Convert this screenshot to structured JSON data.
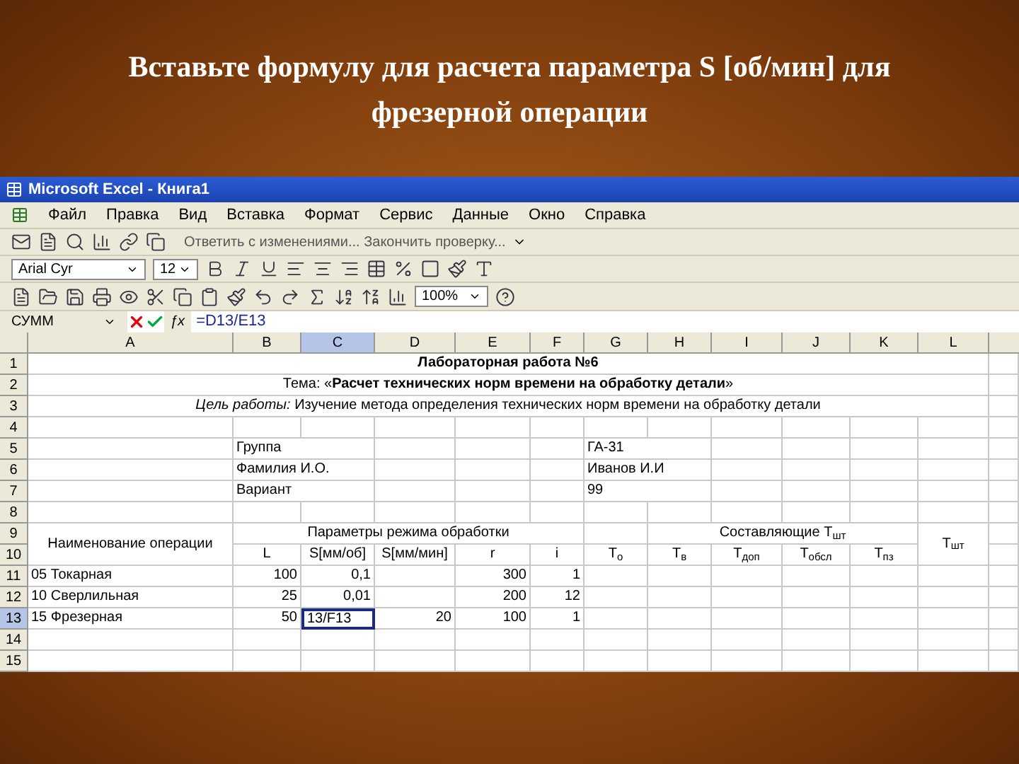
{
  "slide": {
    "title": "Вставьте формулу для расчета параметра S [об/мин] для фрезерной операции"
  },
  "window": {
    "title": "Microsoft Excel - Книга1"
  },
  "menu": [
    "Файл",
    "Правка",
    "Вид",
    "Вставка",
    "Формат",
    "Сервис",
    "Данные",
    "Окно",
    "Справка"
  ],
  "review_toolbar": {
    "text": "Ответить с изменениями...  Закончить проверку..."
  },
  "format_toolbar": {
    "font": "Arial Cyr",
    "size": "12"
  },
  "standard_toolbar": {
    "zoom": "100%"
  },
  "formula_bar": {
    "name_box": "СУММ",
    "formula": "=D13/E13",
    "function_label": "ƒx"
  },
  "columns": [
    {
      "label": "A",
      "selected": false
    },
    {
      "label": "B",
      "selected": false
    },
    {
      "label": "C",
      "selected": true
    },
    {
      "label": "D",
      "selected": false
    },
    {
      "label": "E",
      "selected": false
    },
    {
      "label": "F",
      "selected": false
    },
    {
      "label": "G",
      "selected": false
    },
    {
      "label": "H",
      "selected": false
    },
    {
      "label": "I",
      "selected": false
    },
    {
      "label": "J",
      "selected": false
    },
    {
      "label": "K",
      "selected": false
    },
    {
      "label": "L",
      "selected": false
    }
  ],
  "rows": [
    {
      "number": "1",
      "selected": false,
      "cells": [
        "Лабораторная работа №6"
      ]
    },
    {
      "number": "2",
      "selected": false,
      "cells": [
        "Тема: «**Расчет технических норм времени на обработку детали**»"
      ]
    },
    {
      "number": "3",
      "selected": false,
      "cells": [
        "*Цель работы:* Изучение метода определения технических норм времени на обработку детали"
      ]
    },
    {
      "number": "4",
      "selected": false,
      "cells": []
    },
    {
      "number": "5",
      "selected": false,
      "cells": [
        "Группа",
        "ГА-31"
      ]
    },
    {
      "number": "6",
      "selected": false,
      "cells": [
        "Фамилия И.О.",
        "Иванов И.И"
      ]
    },
    {
      "number": "7",
      "selected": false,
      "cells": [
        "Вариант",
        "99"
      ]
    },
    {
      "number": "8",
      "selected": false,
      "cells": []
    },
    {
      "number": "9",
      "selected": false,
      "cells": [
        "Наименование операции",
        "Параметры режима обработки",
        "Составляющие T$_{шт}$",
        "T$_{шт}$"
      ]
    },
    {
      "number": "10",
      "selected": false,
      "cells": [
        "L",
        "S[мм/об]",
        "S[мм/мин]",
        "r",
        "i",
        "T$_{о}$",
        "T$_{в}$",
        "T$_{доп}$",
        "T$_{обсл}$",
        "T$_{пз}$"
      ]
    },
    {
      "number": "11",
      "selected": false,
      "cells": [
        "05 Токарная",
        "100",
        "0,1",
        "300",
        "1"
      ]
    },
    {
      "number": "12",
      "selected": false,
      "cells": [
        "10 Сверлильная",
        "25",
        "0,01",
        "200",
        "12"
      ]
    },
    {
      "number": "13",
      "selected": true,
      "cells": [
        "15 Фрезерная",
        "50",
        "13/F13",
        "20",
        "100",
        "1"
      ]
    },
    {
      "number": "14",
      "selected": false,
      "cells": []
    },
    {
      "number": "15",
      "selected": false,
      "cells": []
    }
  ]
}
